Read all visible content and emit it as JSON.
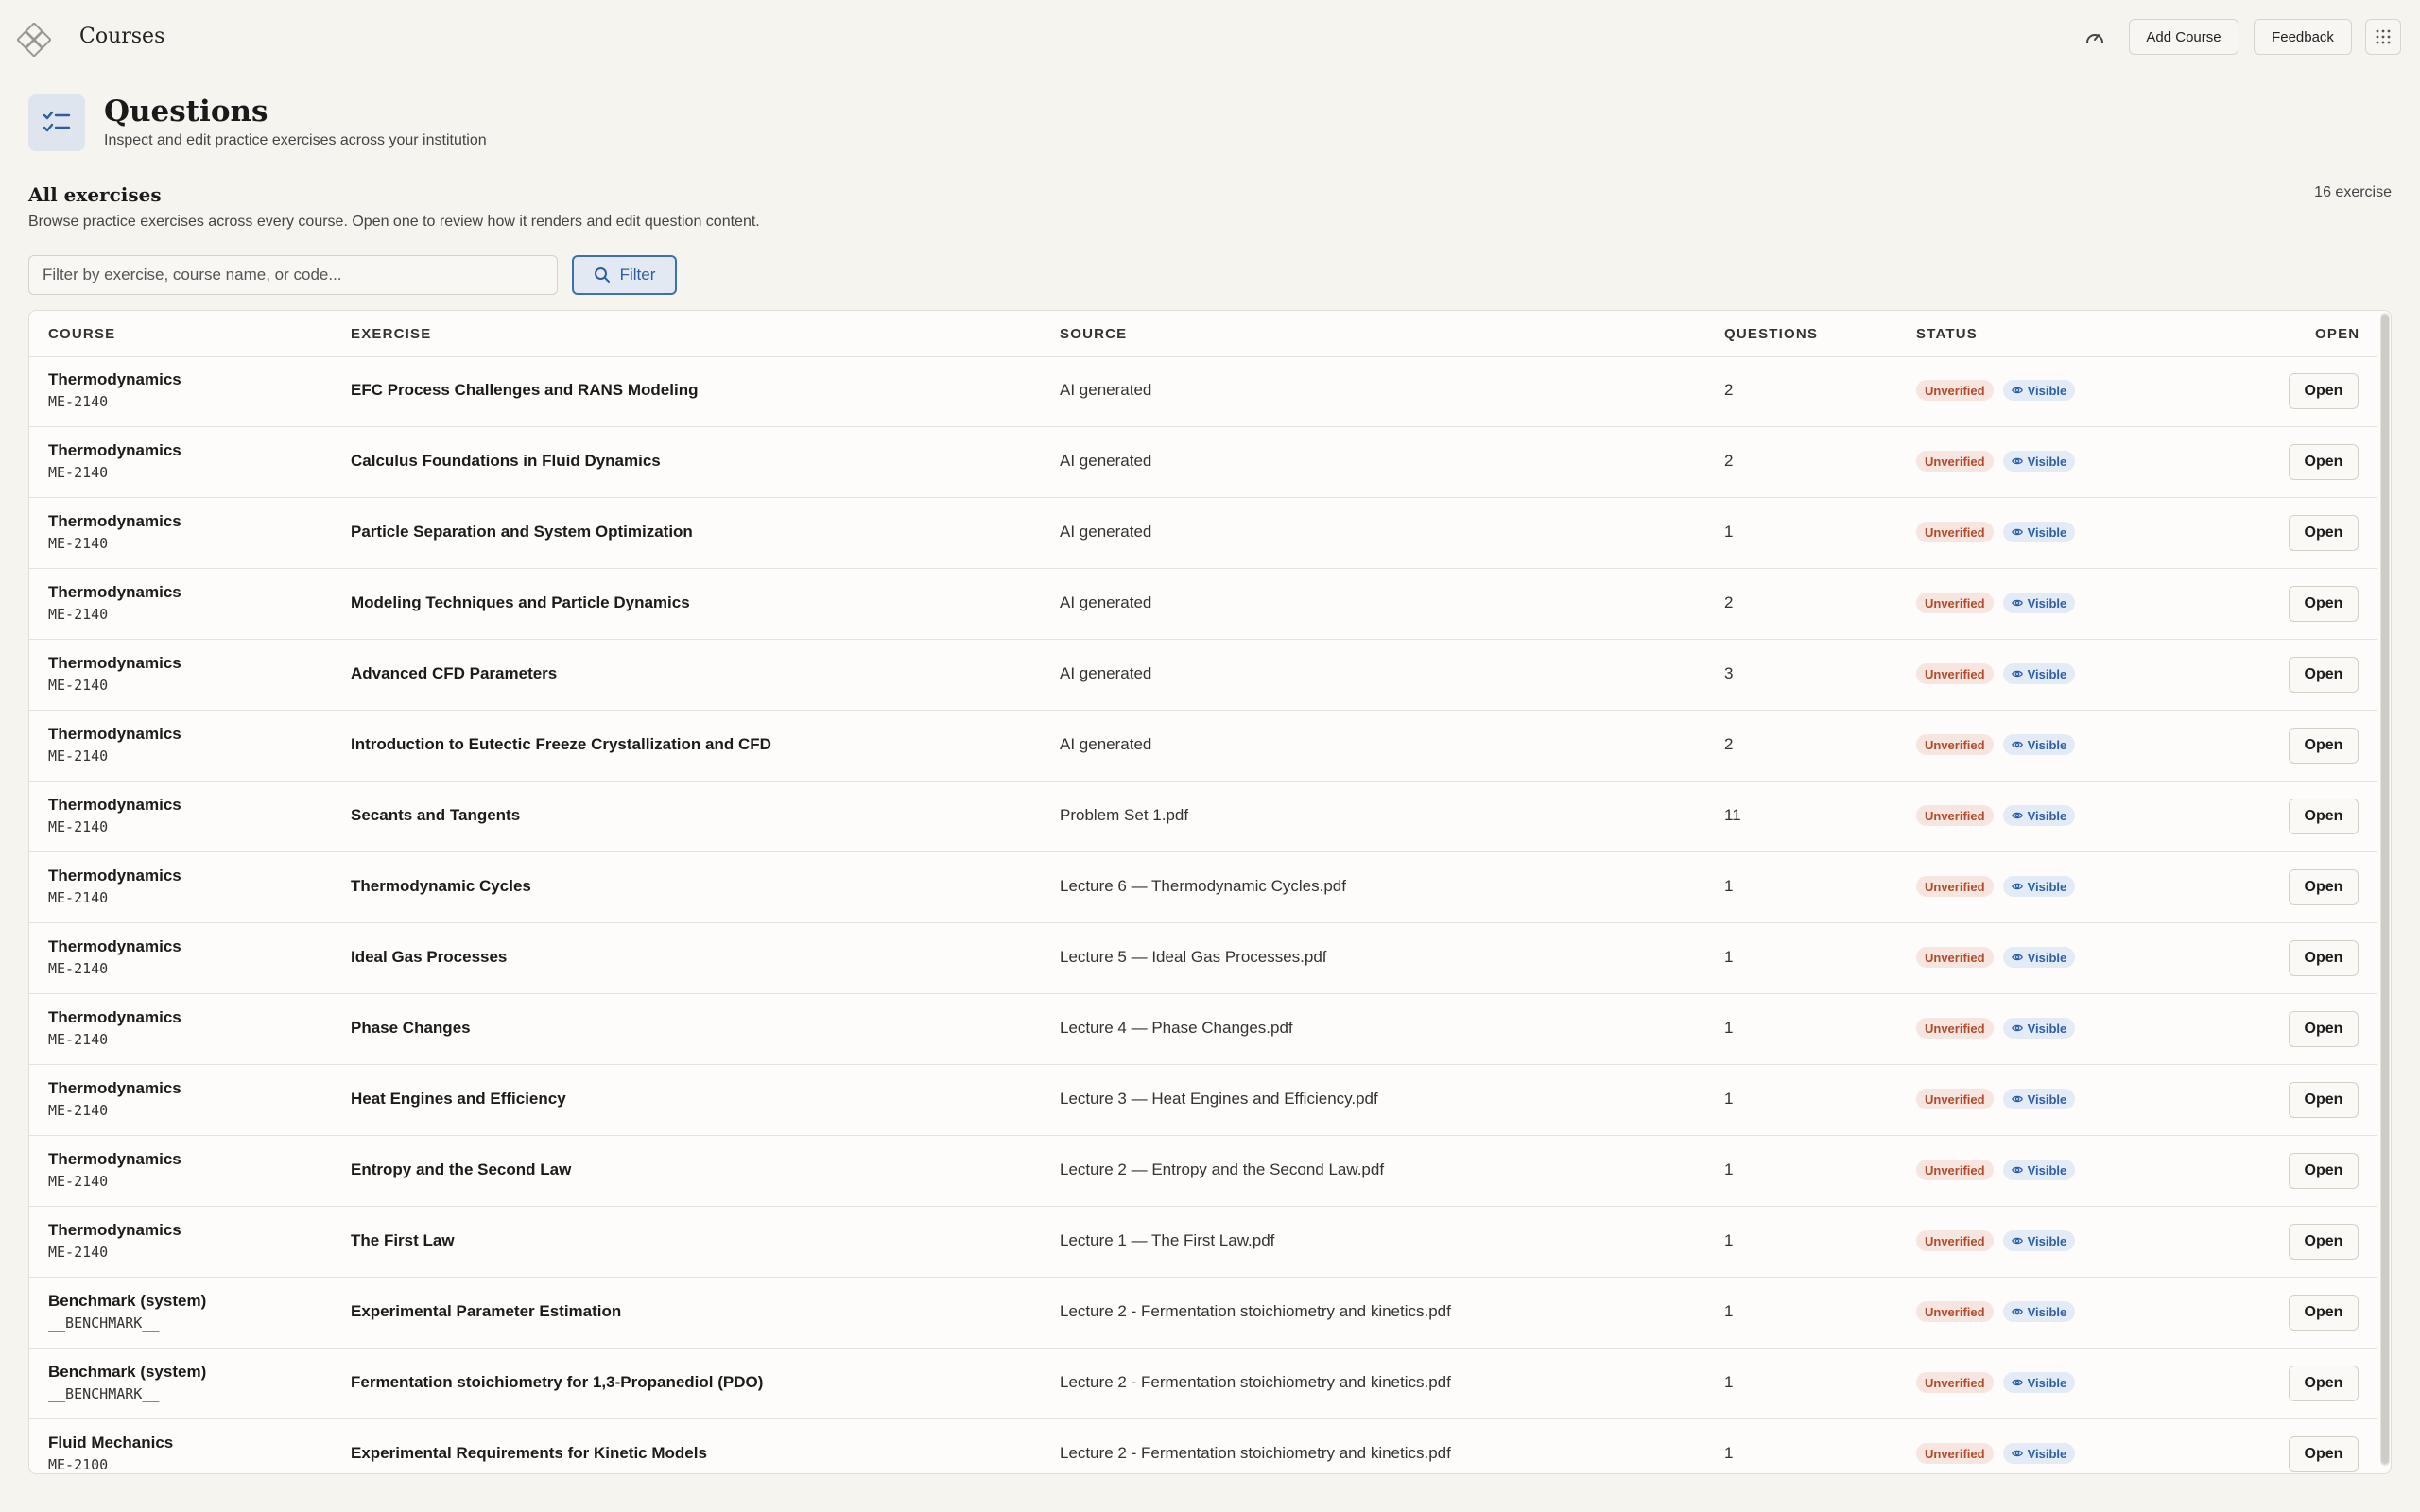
{
  "topbar": {
    "app_title": "Courses",
    "add_course_label": "Add Course",
    "feedback_label": "Feedback"
  },
  "header": {
    "title": "Questions",
    "subtitle": "Inspect and edit practice exercises across your institution"
  },
  "section": {
    "title": "All exercises",
    "description": "Browse practice exercises across every course. Open one to review how it renders and edit question content.",
    "count": "16 exercise"
  },
  "filter": {
    "placeholder": "Filter by exercise, course name, or code...",
    "button_label": "Filter"
  },
  "table": {
    "headers": {
      "course": "COURSE",
      "exercise": "EXERCISE",
      "source": "SOURCE",
      "questions": "QUESTIONS",
      "status": "STATUS",
      "open": "OPEN"
    },
    "rows": [
      {
        "course": "Thermodynamics",
        "code": "ME-2140",
        "exercise": "EFC Process Challenges and RANS Modeling",
        "source": "AI generated",
        "questions": "2",
        "status": "Unverified",
        "visibility": "Visible",
        "action": "Open"
      },
      {
        "course": "Thermodynamics",
        "code": "ME-2140",
        "exercise": "Calculus Foundations in Fluid Dynamics",
        "source": "AI generated",
        "questions": "2",
        "status": "Unverified",
        "visibility": "Visible",
        "action": "Open"
      },
      {
        "course": "Thermodynamics",
        "code": "ME-2140",
        "exercise": "Particle Separation and System Optimization",
        "source": "AI generated",
        "questions": "1",
        "status": "Unverified",
        "visibility": "Visible",
        "action": "Open"
      },
      {
        "course": "Thermodynamics",
        "code": "ME-2140",
        "exercise": "Modeling Techniques and Particle Dynamics",
        "source": "AI generated",
        "questions": "2",
        "status": "Unverified",
        "visibility": "Visible",
        "action": "Open"
      },
      {
        "course": "Thermodynamics",
        "code": "ME-2140",
        "exercise": "Advanced CFD Parameters",
        "source": "AI generated",
        "questions": "3",
        "status": "Unverified",
        "visibility": "Visible",
        "action": "Open"
      },
      {
        "course": "Thermodynamics",
        "code": "ME-2140",
        "exercise": "Introduction to Eutectic Freeze Crystallization and CFD",
        "source": "AI generated",
        "questions": "2",
        "status": "Unverified",
        "visibility": "Visible",
        "action": "Open"
      },
      {
        "course": "Thermodynamics",
        "code": "ME-2140",
        "exercise": "Secants and Tangents",
        "source": "Problem Set 1.pdf",
        "questions": "11",
        "status": "Unverified",
        "visibility": "Visible",
        "action": "Open"
      },
      {
        "course": "Thermodynamics",
        "code": "ME-2140",
        "exercise": "Thermodynamic Cycles",
        "source": "Lecture 6 — Thermodynamic Cycles.pdf",
        "questions": "1",
        "status": "Unverified",
        "visibility": "Visible",
        "action": "Open"
      },
      {
        "course": "Thermodynamics",
        "code": "ME-2140",
        "exercise": "Ideal Gas Processes",
        "source": "Lecture 5 — Ideal Gas Processes.pdf",
        "questions": "1",
        "status": "Unverified",
        "visibility": "Visible",
        "action": "Open"
      },
      {
        "course": "Thermodynamics",
        "code": "ME-2140",
        "exercise": "Phase Changes",
        "source": "Lecture 4 — Phase Changes.pdf",
        "questions": "1",
        "status": "Unverified",
        "visibility": "Visible",
        "action": "Open"
      },
      {
        "course": "Thermodynamics",
        "code": "ME-2140",
        "exercise": "Heat Engines and Efficiency",
        "source": "Lecture 3 — Heat Engines and Efficiency.pdf",
        "questions": "1",
        "status": "Unverified",
        "visibility": "Visible",
        "action": "Open"
      },
      {
        "course": "Thermodynamics",
        "code": "ME-2140",
        "exercise": "Entropy and the Second Law",
        "source": "Lecture 2 — Entropy and the Second Law.pdf",
        "questions": "1",
        "status": "Unverified",
        "visibility": "Visible",
        "action": "Open"
      },
      {
        "course": "Thermodynamics",
        "code": "ME-2140",
        "exercise": "The First Law",
        "source": "Lecture 1 — The First Law.pdf",
        "questions": "1",
        "status": "Unverified",
        "visibility": "Visible",
        "action": "Open"
      },
      {
        "course": "Benchmark (system)",
        "code": "__BENCHMARK__",
        "exercise": "Experimental Parameter Estimation",
        "source": "Lecture 2 - Fermentation stoichiometry and kinetics.pdf",
        "questions": "1",
        "status": "Unverified",
        "visibility": "Visible",
        "action": "Open"
      },
      {
        "course": "Benchmark (system)",
        "code": "__BENCHMARK__",
        "exercise": "Fermentation stoichiometry for 1,3-Propanediol (PDO)",
        "source": "Lecture 2 - Fermentation stoichiometry and kinetics.pdf",
        "questions": "1",
        "status": "Unverified",
        "visibility": "Visible",
        "action": "Open"
      },
      {
        "course": "Fluid Mechanics",
        "code": "ME-2100",
        "exercise": "Experimental Requirements for Kinetic Models",
        "source": "Lecture 2 - Fermentation stoichiometry and kinetics.pdf",
        "questions": "1",
        "status": "Unverified",
        "visibility": "Visible",
        "action": "Open"
      }
    ]
  },
  "colors": {
    "background": "#f6f4ef",
    "accent": "#2d5da0",
    "unverified_text": "#b24a2c",
    "unverified_bg": "#f6e6df",
    "visible_text": "#2c5fa8",
    "visible_bg": "#e3ebf6"
  },
  "icons": {
    "logo": "diamond-logo-icon",
    "speed": "gauge-icon",
    "apps": "grid-dots-icon",
    "header": "checklist-icon",
    "filter": "search-icon",
    "visible": "eye-icon"
  }
}
